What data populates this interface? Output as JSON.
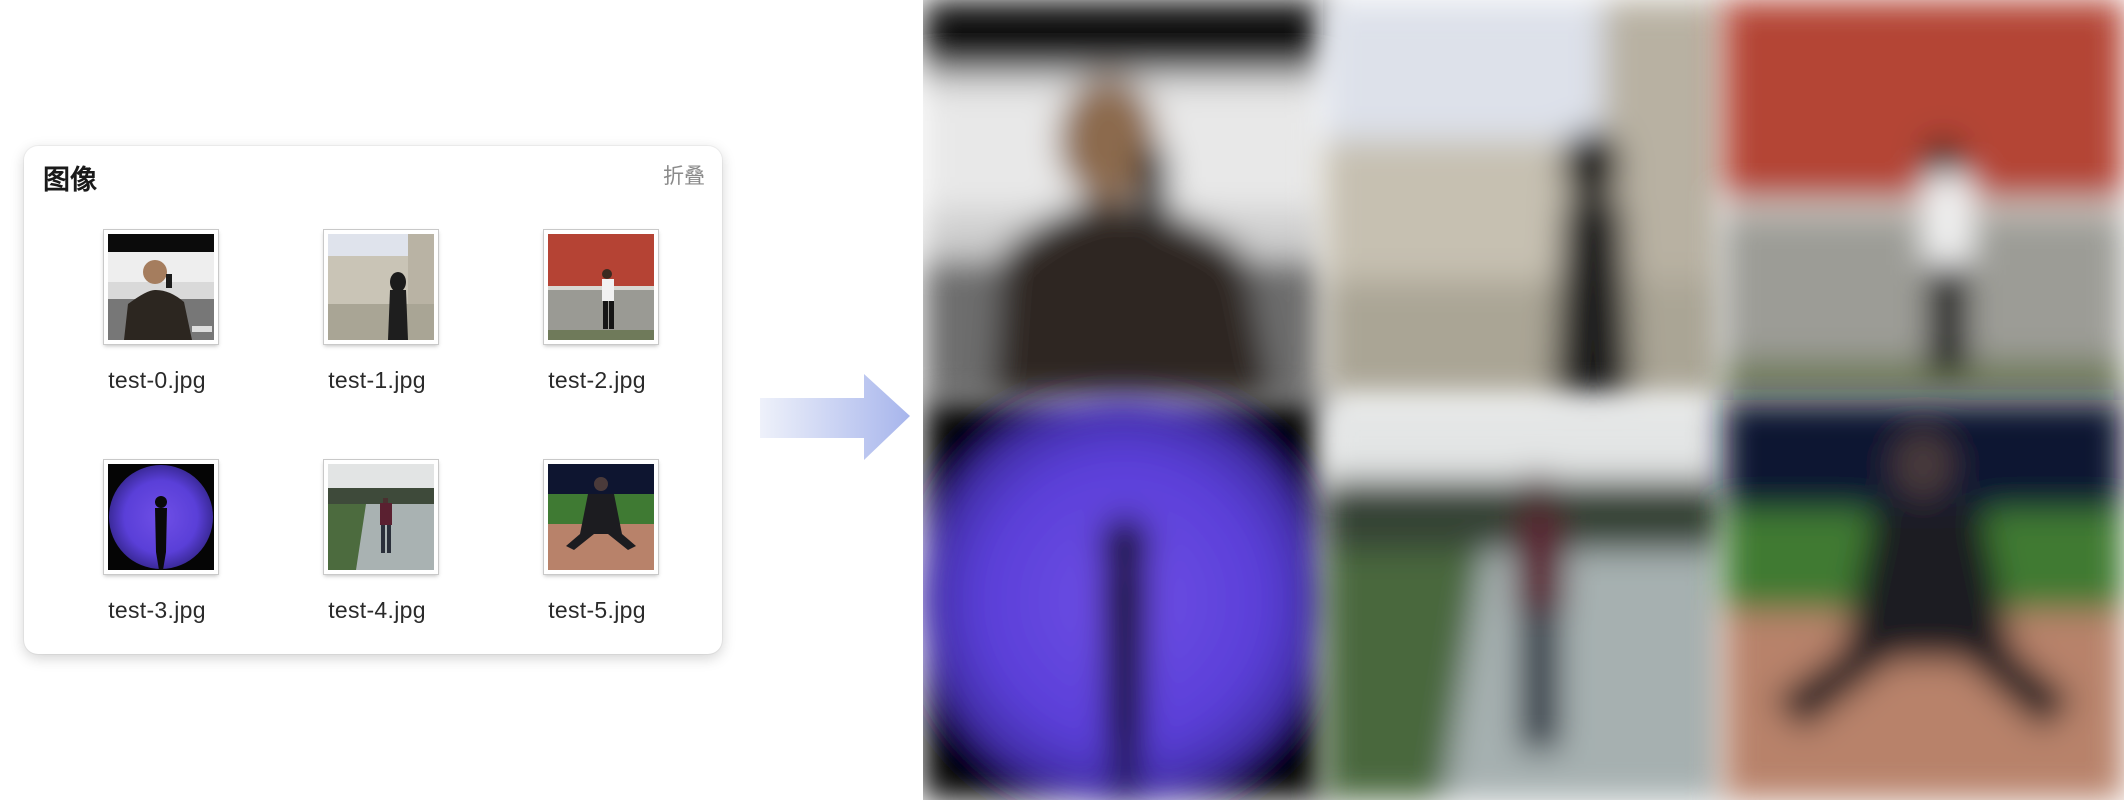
{
  "panel": {
    "title": "图像",
    "collapse_label": "折叠"
  },
  "files": [
    {
      "name": "test-0.jpg"
    },
    {
      "name": "test-1.jpg"
    },
    {
      "name": "test-2.jpg"
    },
    {
      "name": "test-3.jpg"
    },
    {
      "name": "test-4.jpg"
    },
    {
      "name": "test-5.jpg"
    }
  ],
  "colors": {
    "arrow_start": "#e6ebf8",
    "arrow_end": "#a8b6ec",
    "wall_red": "#b44536",
    "purple_light": "#6a4be0"
  },
  "icons": {
    "arrow": "right-arrow-icon"
  }
}
